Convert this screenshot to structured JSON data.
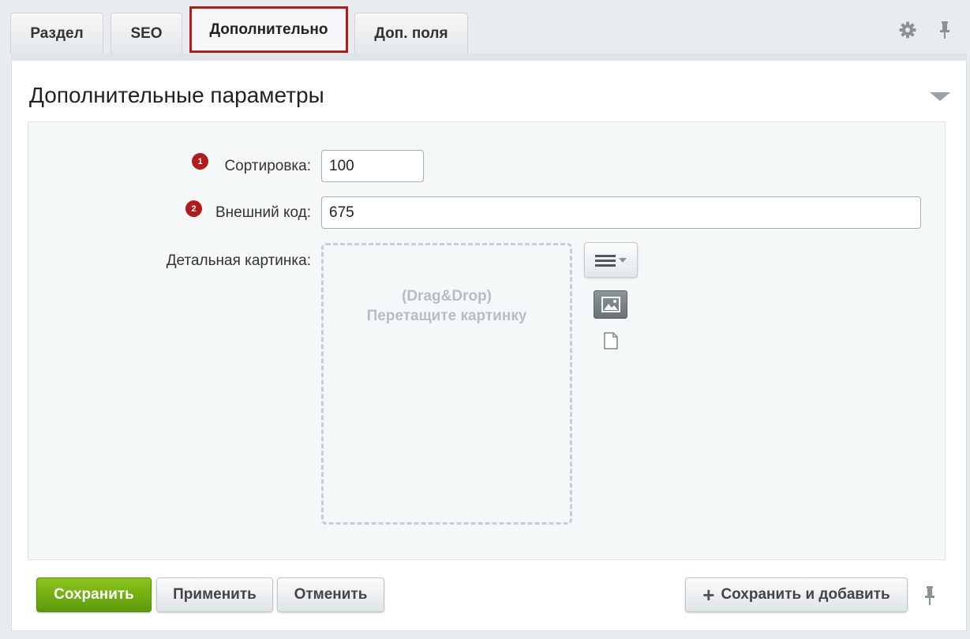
{
  "tabs": [
    {
      "label": "Раздел",
      "active": false
    },
    {
      "label": "SEO",
      "active": false
    },
    {
      "label": "Дополнительно",
      "active": true
    },
    {
      "label": "Доп. поля",
      "active": false
    }
  ],
  "tab_tools": {
    "settings_icon": "gear-icon",
    "pin_icon": "pin-icon"
  },
  "panel": {
    "title": "Дополнительные параметры",
    "collapse_icon": "chevron-down-icon"
  },
  "form": {
    "sort": {
      "badge": "1",
      "label": "Сортировка:",
      "value": "100"
    },
    "external_code": {
      "badge": "2",
      "label": "Внешний код:",
      "value": "675"
    },
    "detail_picture": {
      "label": "Детальная картинка:",
      "dropzone_line1": "(Drag&Drop)",
      "dropzone_line2": "Перетащите картинку",
      "menu_icon": "hamburger-menu-icon",
      "image_icon": "image-icon",
      "file_icon": "file-icon"
    }
  },
  "footer": {
    "save_label": "Сохранить",
    "apply_label": "Применить",
    "cancel_label": "Отменить",
    "save_add_label": "Сохранить и добавить",
    "pin_icon": "pin-icon"
  },
  "colors": {
    "accent_red": "#b01c1c",
    "save_green": "#6fab12"
  }
}
